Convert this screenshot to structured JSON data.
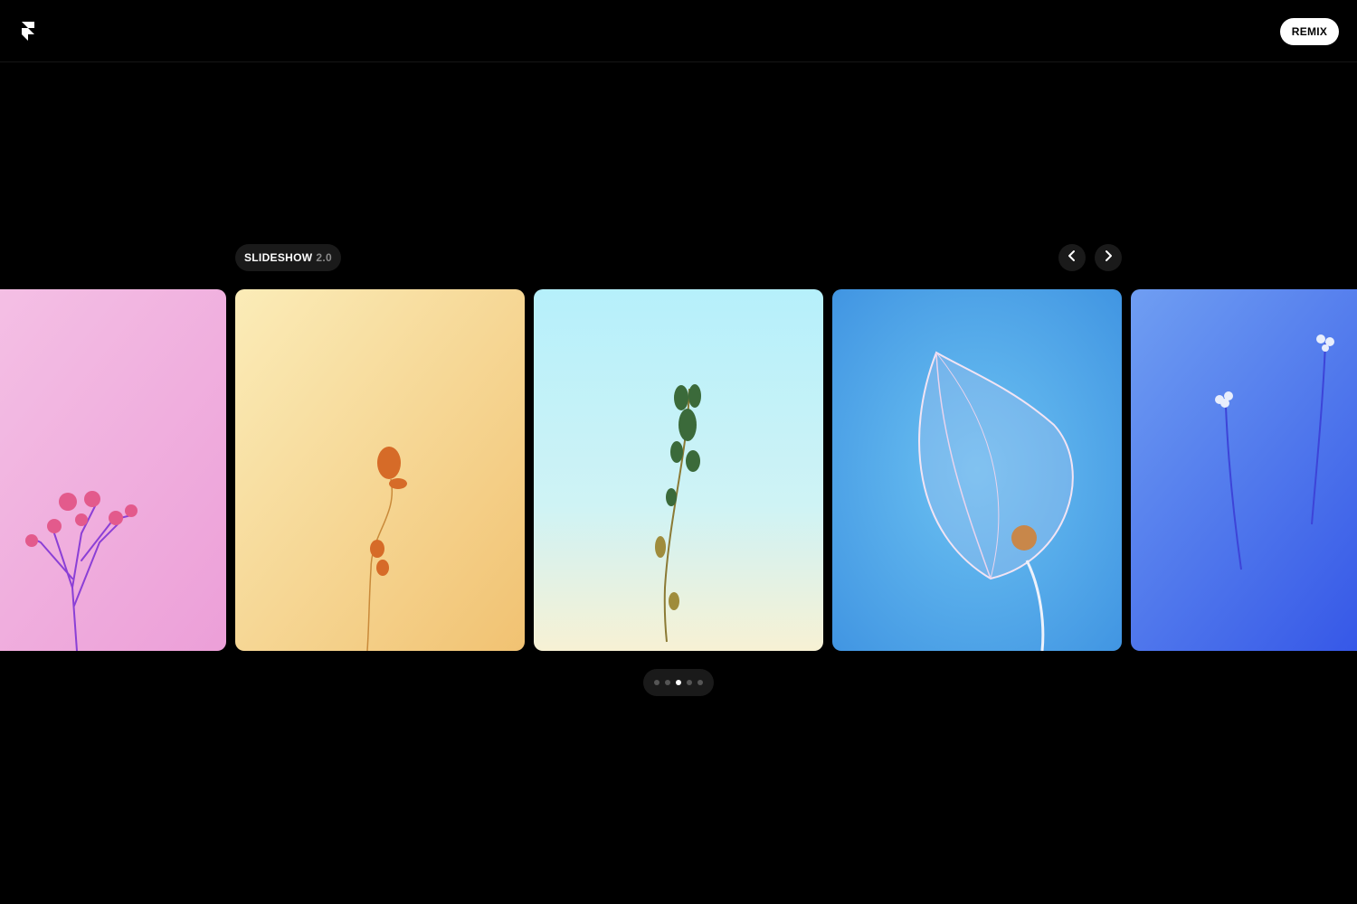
{
  "header": {
    "logo_icon": "framer-logo-icon",
    "remix_label": "REMIX"
  },
  "slideshow": {
    "title": "SLIDESHOW",
    "version": "2.0",
    "prev_icon": "chevron-left-icon",
    "next_icon": "chevron-right-icon",
    "slides": [
      {
        "subject": "pink wildflower",
        "background": "#f2b8e0"
      },
      {
        "subject": "dried orange flower",
        "background": "#f5d389"
      },
      {
        "subject": "green dried herb",
        "background": "#bff0f7"
      },
      {
        "subject": "physalis lantern skeleton",
        "background": "#5db4ec"
      },
      {
        "subject": "blue small flowers",
        "background": "#4a78ee"
      }
    ],
    "dots": {
      "count": 5,
      "active_index": 2
    }
  },
  "colors": {
    "background": "#000000",
    "pill": "#1a1a1a",
    "muted_text": "#8a8a8a",
    "accent_white": "#ffffff"
  }
}
